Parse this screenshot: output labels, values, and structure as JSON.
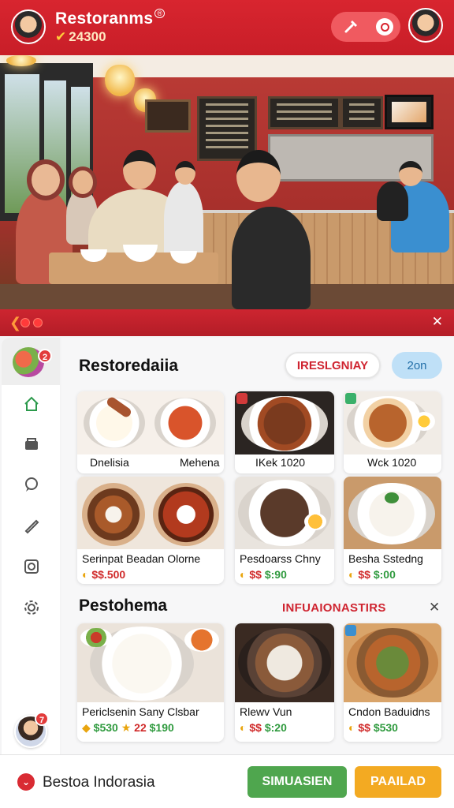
{
  "header": {
    "title": "Restoranms",
    "title_mark": "®",
    "coins": "24300",
    "icons": [
      "chef-avatar",
      "hammer-icon",
      "search-icon",
      "profile-avatar"
    ]
  },
  "panel": {
    "back_icon": "chevron-left-icon",
    "close_icon": "close-icon"
  },
  "sidebar": {
    "notification_count": "2",
    "items": [
      "home-icon",
      "store-icon",
      "chat-icon",
      "tag-icon",
      "camera-icon",
      "settings-icon"
    ],
    "active": "home-icon",
    "user_badge": "7"
  },
  "section1": {
    "title": "Restoredaiia",
    "chip_primary": "IRESLGNIAY",
    "chip_secondary": "2on",
    "cards": [
      {
        "name": "Dnelisia"
      },
      {
        "name": "Mehena"
      },
      {
        "name": "IKek 1020"
      },
      {
        "name": "Wck 1020"
      },
      {
        "name": "Serinpat Beadan Olorne",
        "price_red": "$$.500",
        "price_green": ""
      },
      {
        "name": "Pesdoarss Chny",
        "price_red": "$$",
        "price_green": "$:90"
      },
      {
        "name": "Besha Sstedng",
        "price_red": "$$",
        "price_green": "$:00"
      }
    ]
  },
  "section2": {
    "title": "Pestohema",
    "link": "INFUAIONASTIRS",
    "close_icon": "close-icon",
    "cards": [
      {
        "name": "Periclsenin Sany Clsbar",
        "price_green": "$530",
        "price_star": "22",
        "price_green2": "$190"
      },
      {
        "name": "Rlewv Vun",
        "price_red": "$$",
        "price_green": "$:20"
      },
      {
        "name": "Cndon Baduidns",
        "price_red": "$$",
        "price_green": "$530"
      }
    ]
  },
  "footer": {
    "location": "Bestoa Indorasia",
    "btn_green": "SIMUASIEN",
    "btn_orange": "PAAILAD"
  },
  "colors": {
    "brand_red": "#d8252f",
    "accent_green": "#4fa64e",
    "accent_orange": "#f3aa22",
    "chip_blue": "#bfe0f7"
  }
}
